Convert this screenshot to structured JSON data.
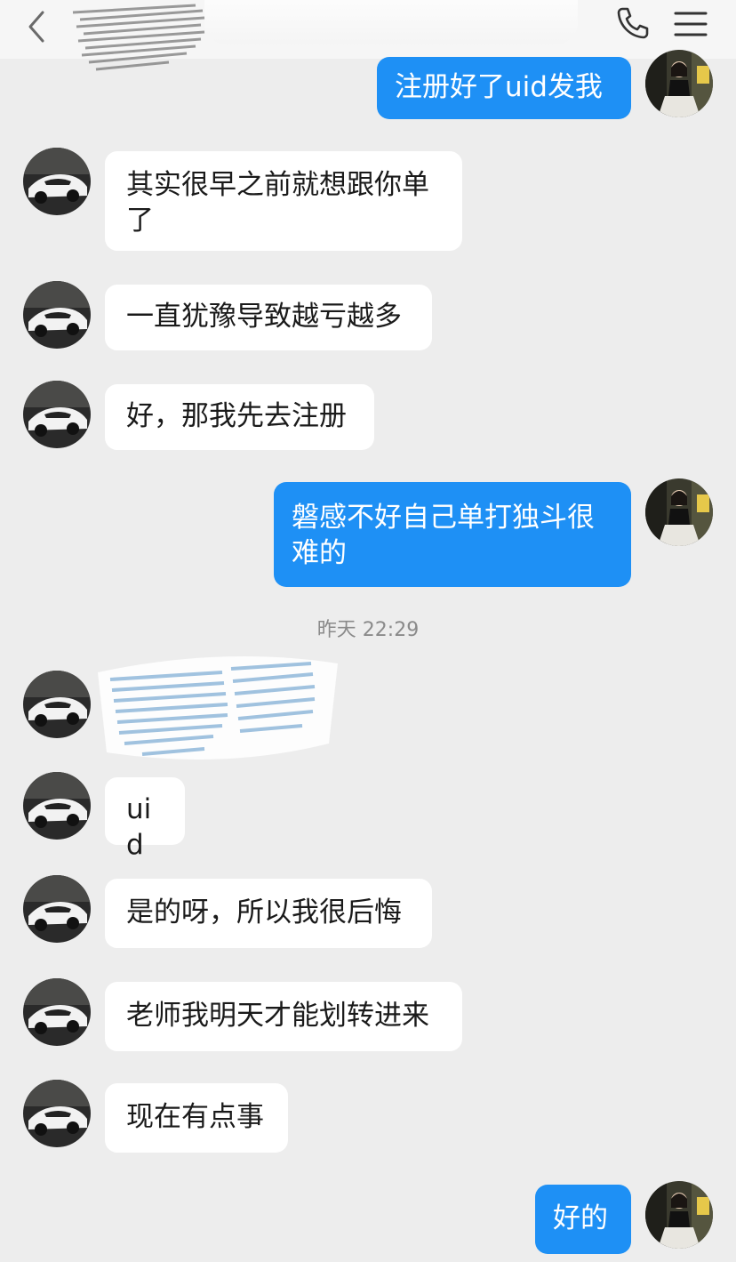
{
  "header": {
    "back_icon": "chevron-left-icon",
    "phone_icon": "phone-icon",
    "menu_icon": "hamburger-menu-icon"
  },
  "colors": {
    "background": "#ededed",
    "outgoing_bubble": "#1e90f5",
    "incoming_bubble": "#ffffff"
  },
  "messages": [
    {
      "direction": "out",
      "text": "注册好了uid发我"
    },
    {
      "direction": "in",
      "text": "其实很早之前就想跟你单了"
    },
    {
      "direction": "in",
      "text": "一直犹豫导致越亏越多"
    },
    {
      "direction": "in",
      "text": "好，那我先去注册"
    },
    {
      "direction": "out",
      "text": "磐感不好自己单打独斗很难的"
    },
    {
      "direction": "in",
      "text": "uid"
    },
    {
      "direction": "in",
      "text": "是的呀，所以我很后悔"
    },
    {
      "direction": "in",
      "text": "老师我明天才能划转进来"
    },
    {
      "direction": "in",
      "text": "现在有点事"
    },
    {
      "direction": "out",
      "text": "好的"
    }
  ],
  "timestamp": "昨天 22:29"
}
